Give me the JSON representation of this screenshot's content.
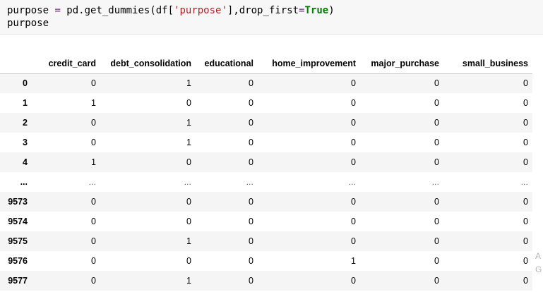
{
  "code": {
    "line1": {
      "var": "purpose ",
      "eq": "=",
      "call": " pd.get_dummies(df[",
      "str": "'purpose'",
      "mid": "],drop_first",
      "eq2": "=",
      "kw": "True",
      "end": ")"
    },
    "line2": "purpose"
  },
  "table": {
    "columns": [
      "",
      "credit_card",
      "debt_consolidation",
      "educational",
      "home_improvement",
      "major_purchase",
      "small_business"
    ],
    "rows": [
      [
        "0",
        "0",
        "1",
        "0",
        "0",
        "0",
        "0"
      ],
      [
        "1",
        "1",
        "0",
        "0",
        "0",
        "0",
        "0"
      ],
      [
        "2",
        "0",
        "1",
        "0",
        "0",
        "0",
        "0"
      ],
      [
        "3",
        "0",
        "1",
        "0",
        "0",
        "0",
        "0"
      ],
      [
        "4",
        "1",
        "0",
        "0",
        "0",
        "0",
        "0"
      ],
      [
        "...",
        "...",
        "...",
        "...",
        "...",
        "...",
        "..."
      ],
      [
        "9573",
        "0",
        "0",
        "0",
        "0",
        "0",
        "0"
      ],
      [
        "9574",
        "0",
        "0",
        "0",
        "0",
        "0",
        "0"
      ],
      [
        "9575",
        "0",
        "1",
        "0",
        "0",
        "0",
        "0"
      ],
      [
        "9576",
        "0",
        "0",
        "0",
        "1",
        "0",
        "0"
      ],
      [
        "9577",
        "0",
        "1",
        "0",
        "0",
        "0",
        "0"
      ]
    ]
  },
  "watermark": [
    "A",
    "G"
  ]
}
